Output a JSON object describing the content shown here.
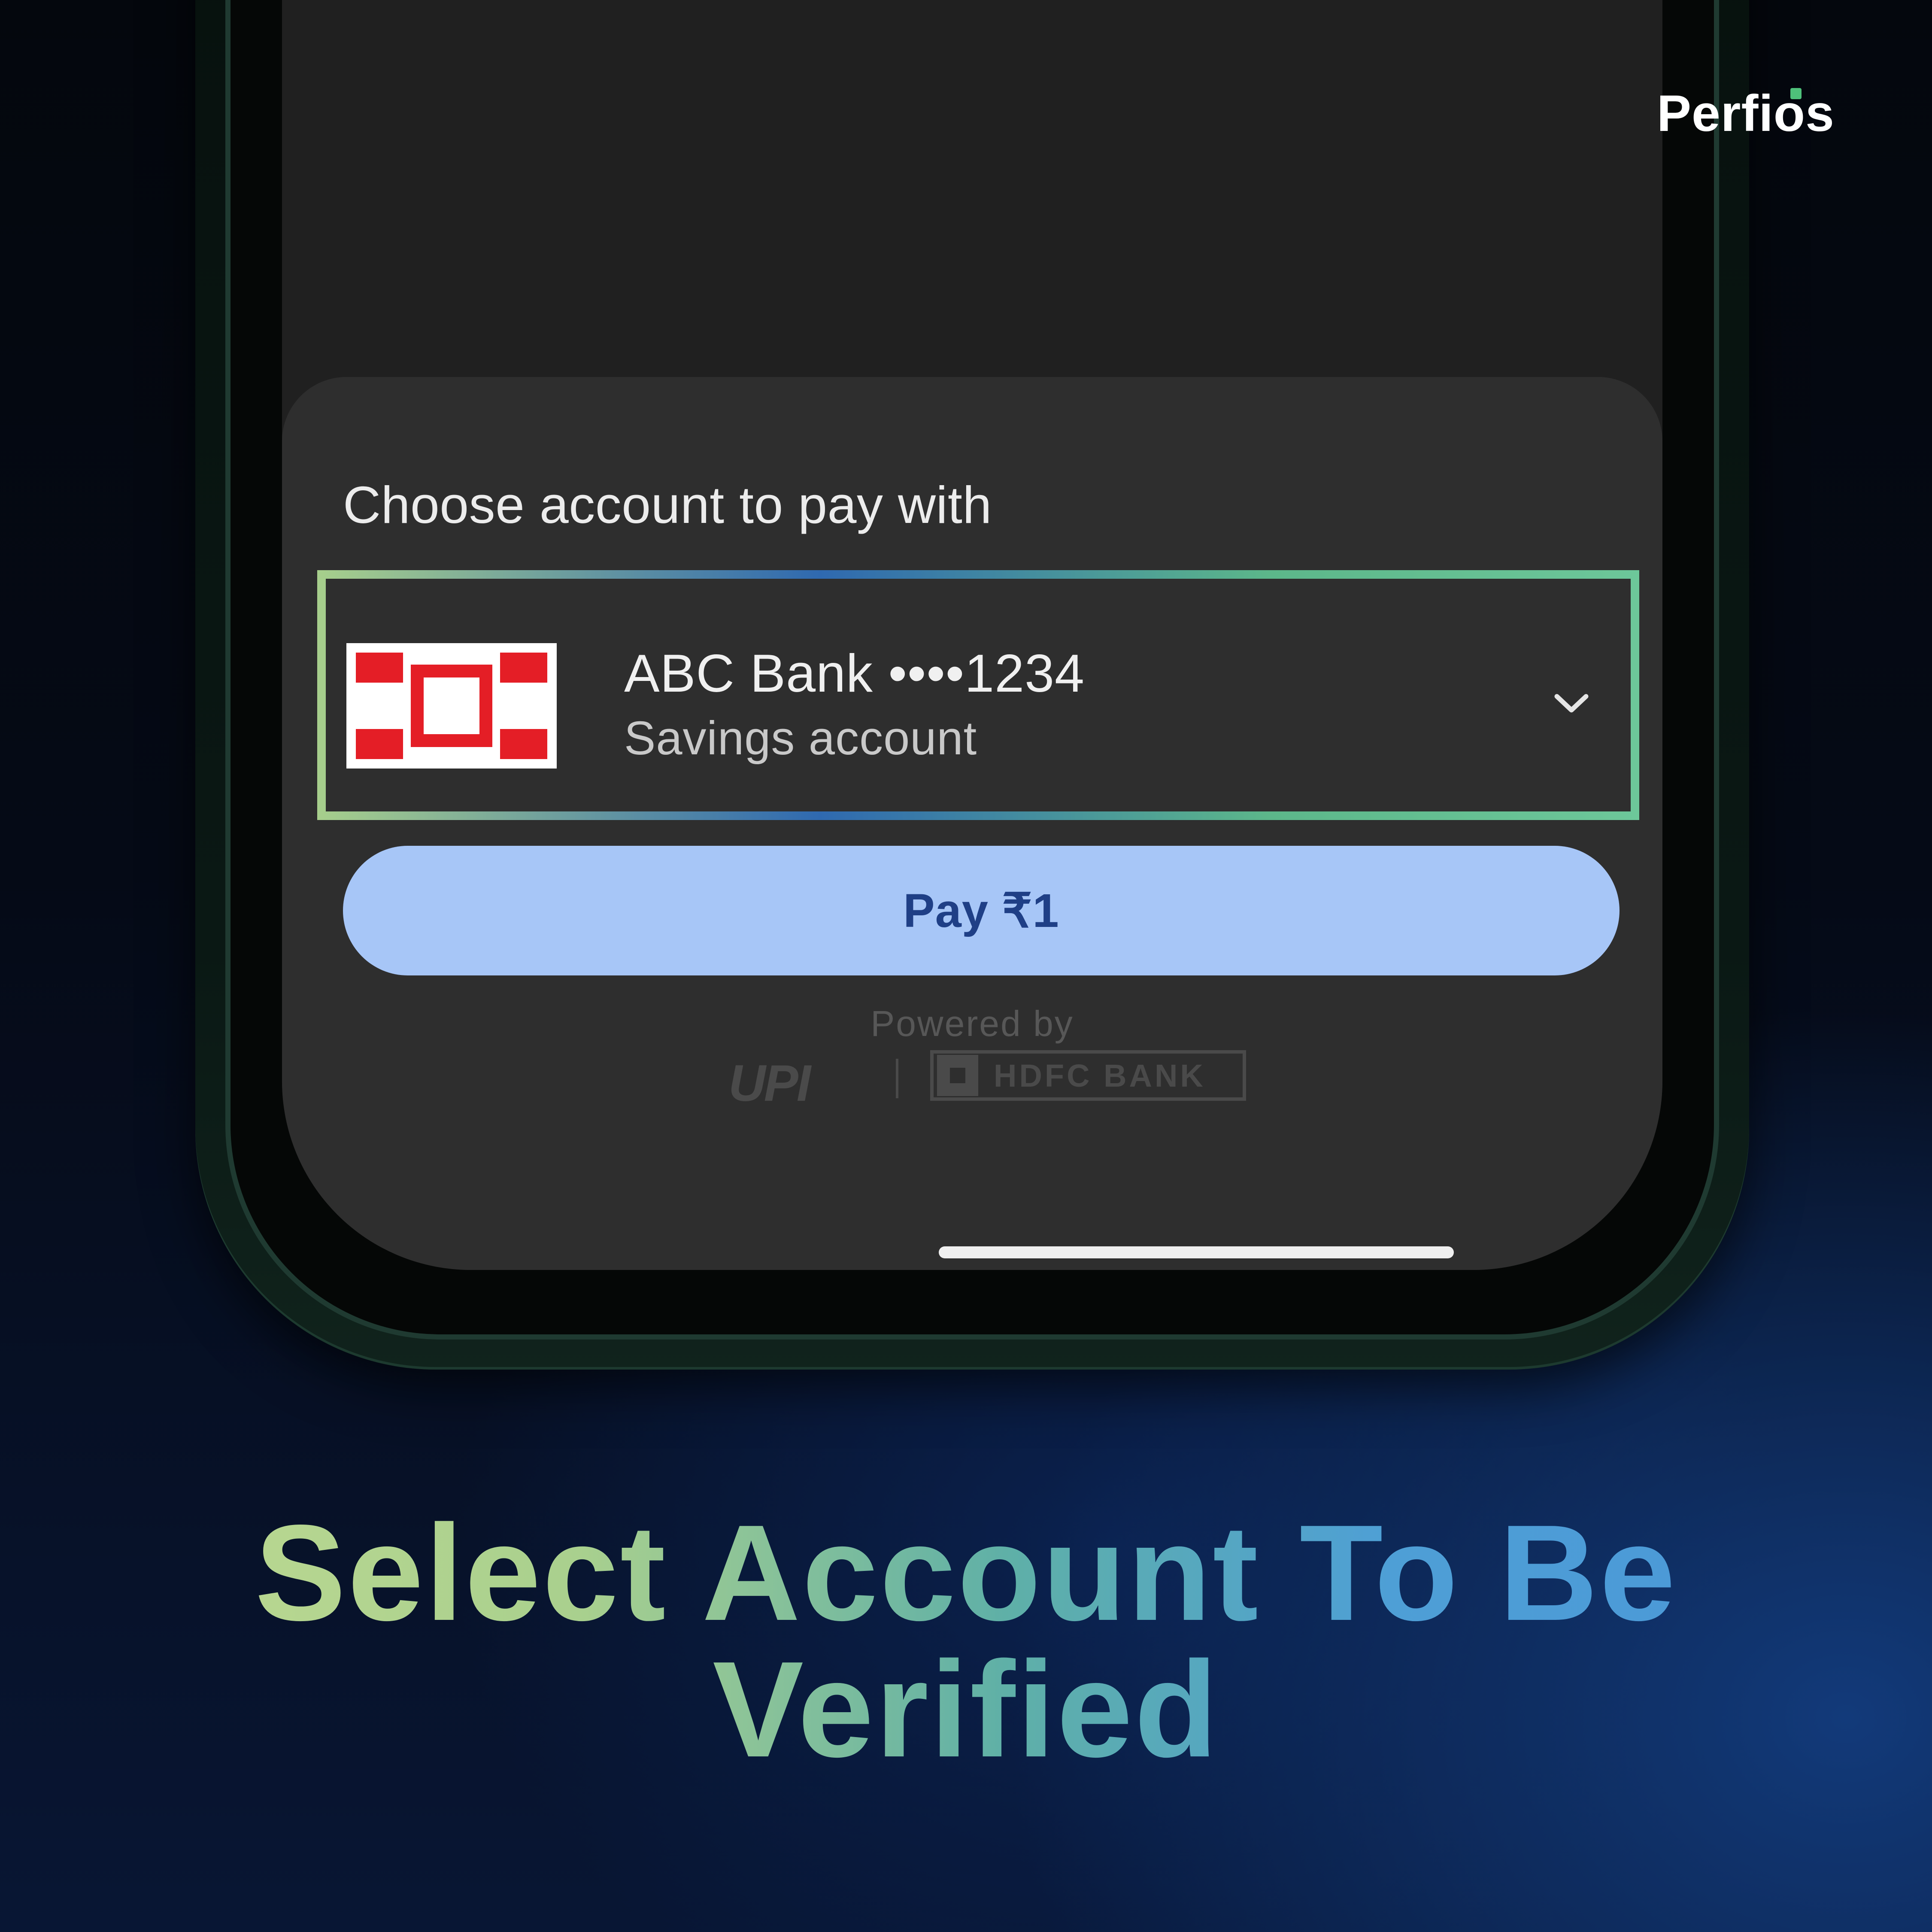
{
  "brand": {
    "logo_text": "Perfios",
    "accent_color": "#4ec07a"
  },
  "phone": {
    "sheet": {
      "title": "Choose account to pay with",
      "account": {
        "bank_name": "ABC Bank",
        "masked_number": "••••1234",
        "display": "ABC Bank ••••1234",
        "type": "Savings account",
        "logo_icon": "bank-logo-icon",
        "logo_colors": [
          "#e41e26",
          "#ffffff"
        ],
        "dropdown_icon": "chevron-down-icon"
      },
      "pay_button_label": "Pay ₹1",
      "pay_button_color": "#a7c6f7",
      "powered_by": "Powered by",
      "partner_logos": {
        "upi": "UPI",
        "hdfc": "HDFC BANK"
      }
    }
  },
  "headline": {
    "text": "Select Account To Be Verified",
    "gradient_colors": [
      "#c2db92",
      "#5fb0a7",
      "#4a96d8"
    ]
  }
}
